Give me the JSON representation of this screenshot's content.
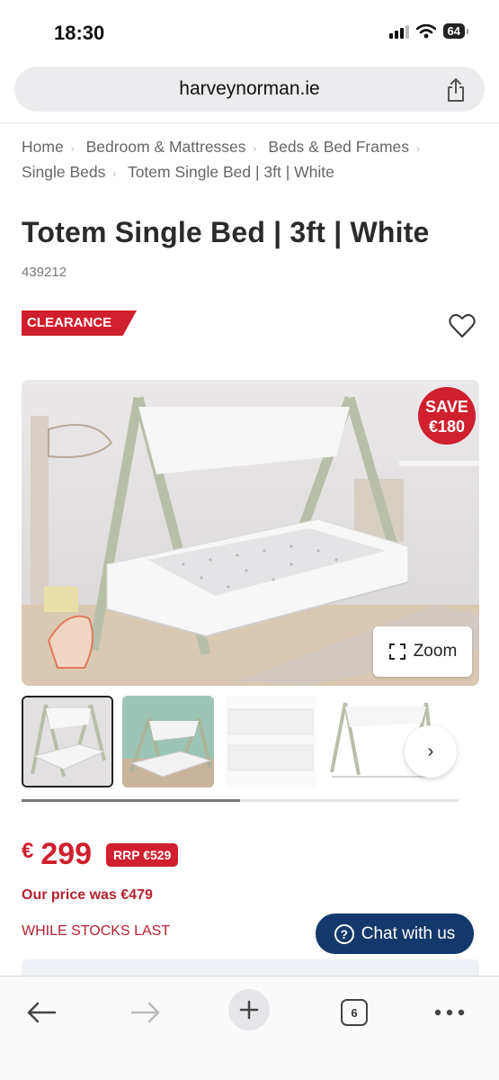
{
  "status_bar": {
    "time": "18:30",
    "battery": "64"
  },
  "browser": {
    "url": "harveynorman.ie",
    "tab_count": "6"
  },
  "breadcrumb": [
    "Home",
    "Bedroom & Mattresses",
    "Beds & Bed Frames",
    "Single Beds",
    "Totem Single Bed | 3ft | White"
  ],
  "product": {
    "title": "Totem Single Bed | 3ft | White",
    "sku": "439212",
    "badge": "CLEARANCE",
    "save_line1": "SAVE",
    "save_line2": "€180",
    "zoom_label": "Zoom",
    "currency": "€",
    "price": "299",
    "rrp": "RRP €529",
    "was_price": "Our price was €479",
    "stock_note": "WHILE STOCKS LAST",
    "gallery_progress": 0.5
  },
  "chat": {
    "label": "Chat with us"
  },
  "colors": {
    "brand_red": "#d01f2e",
    "chat_blue": "#14386b"
  }
}
